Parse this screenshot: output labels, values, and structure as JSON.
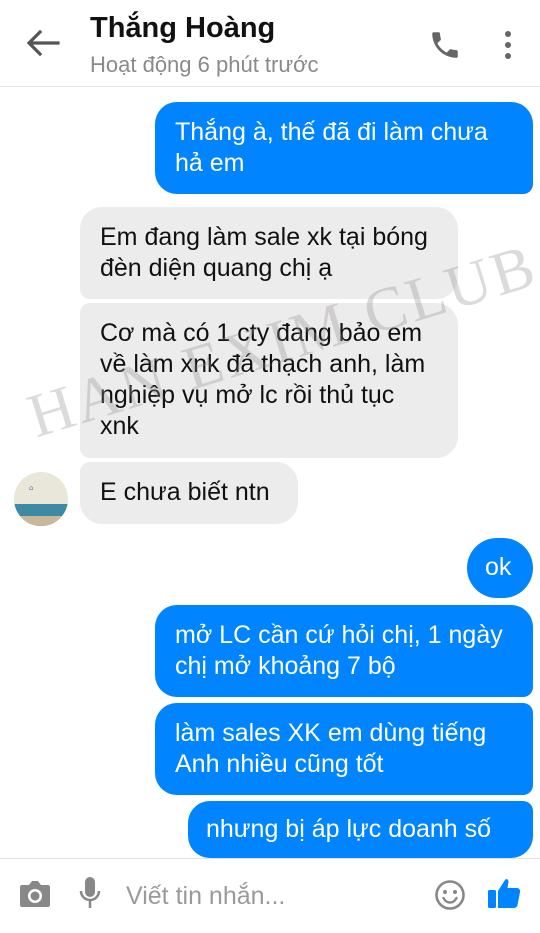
{
  "header": {
    "contact_name": "Thắng Hoàng",
    "status": "Hoạt động 6 phút trước"
  },
  "messages": [
    {
      "direction": "outgoing",
      "text": "Thắng à, thế đã đi làm chưa hả em"
    },
    {
      "direction": "incoming",
      "text": "Em đang làm sale xk tại bóng đèn diện quang chị ạ"
    },
    {
      "direction": "incoming",
      "text": "Cơ mà có 1 cty đang bảo em về làm xnk đá thạch anh, làm nghiệp vụ mở lc rồi thủ tục xnk"
    },
    {
      "direction": "incoming",
      "text": "E chưa biết ntn"
    },
    {
      "direction": "outgoing",
      "text": "ok"
    },
    {
      "direction": "outgoing",
      "text": "mở LC cần cứ hỏi chị, 1 ngày chị mở khoảng 7 bộ"
    },
    {
      "direction": "outgoing",
      "text": "làm sales XK em dùng tiếng Anh nhiều cũng tốt"
    },
    {
      "direction": "outgoing",
      "text": "nhưng bị áp lực doanh số"
    }
  ],
  "watermark": "HAN EXIM CLUB",
  "composer": {
    "placeholder": "Viết tin nhắn..."
  },
  "icons": {
    "back": "arrow-left-icon",
    "call": "phone-icon",
    "more": "more-vertical-icon",
    "camera": "camera-icon",
    "mic": "microphone-icon",
    "emoji": "emoji-icon",
    "like": "thumbs-up-icon"
  },
  "colors": {
    "outgoing_bubble": "#0084ff",
    "incoming_bubble": "#ececec",
    "accent": "#0084ff"
  }
}
